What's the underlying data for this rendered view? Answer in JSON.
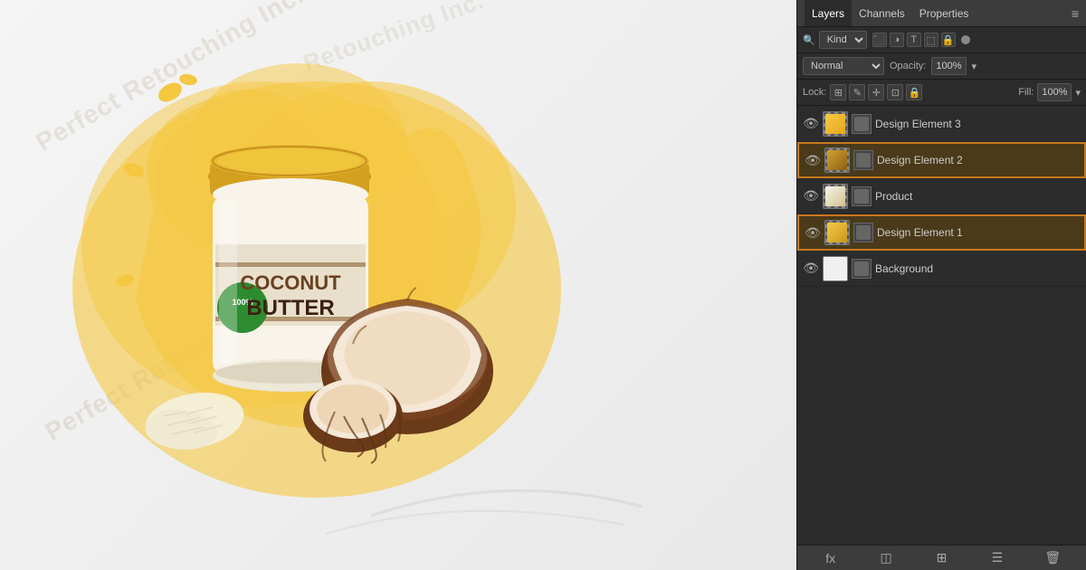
{
  "illustration": {
    "watermark1": "Perfect Retouching Inc.",
    "watermark2": "Perfect Retouching Inc.",
    "watermark_corner": "Retouching Inc."
  },
  "panel": {
    "tabs": [
      {
        "label": "Layers",
        "active": true
      },
      {
        "label": "Channels",
        "active": false
      },
      {
        "label": "Properties",
        "active": false
      }
    ],
    "filter": {
      "label": "Kind",
      "icons": [
        "⬛",
        "◑",
        "T",
        "⬚",
        "🔒",
        "●"
      ]
    },
    "blend": {
      "mode": "Normal",
      "opacity_label": "Opacity:",
      "opacity_value": "100%"
    },
    "lock": {
      "label": "Lock:",
      "icons": [
        "⊞",
        "✎",
        "✛",
        "⊡",
        "🔒"
      ],
      "fill_label": "Fill:",
      "fill_value": "100%"
    },
    "layers": [
      {
        "name": "Design Element 3",
        "visible": true,
        "selected": false
      },
      {
        "name": "Design Element 2",
        "visible": true,
        "selected": true
      },
      {
        "name": "Product",
        "visible": true,
        "selected": false
      },
      {
        "name": "Design Element 1",
        "visible": true,
        "selected": true
      },
      {
        "name": "Background",
        "visible": true,
        "selected": false
      }
    ],
    "bottom_icons": [
      "fx",
      "◫",
      "⊞",
      "🗑"
    ]
  }
}
